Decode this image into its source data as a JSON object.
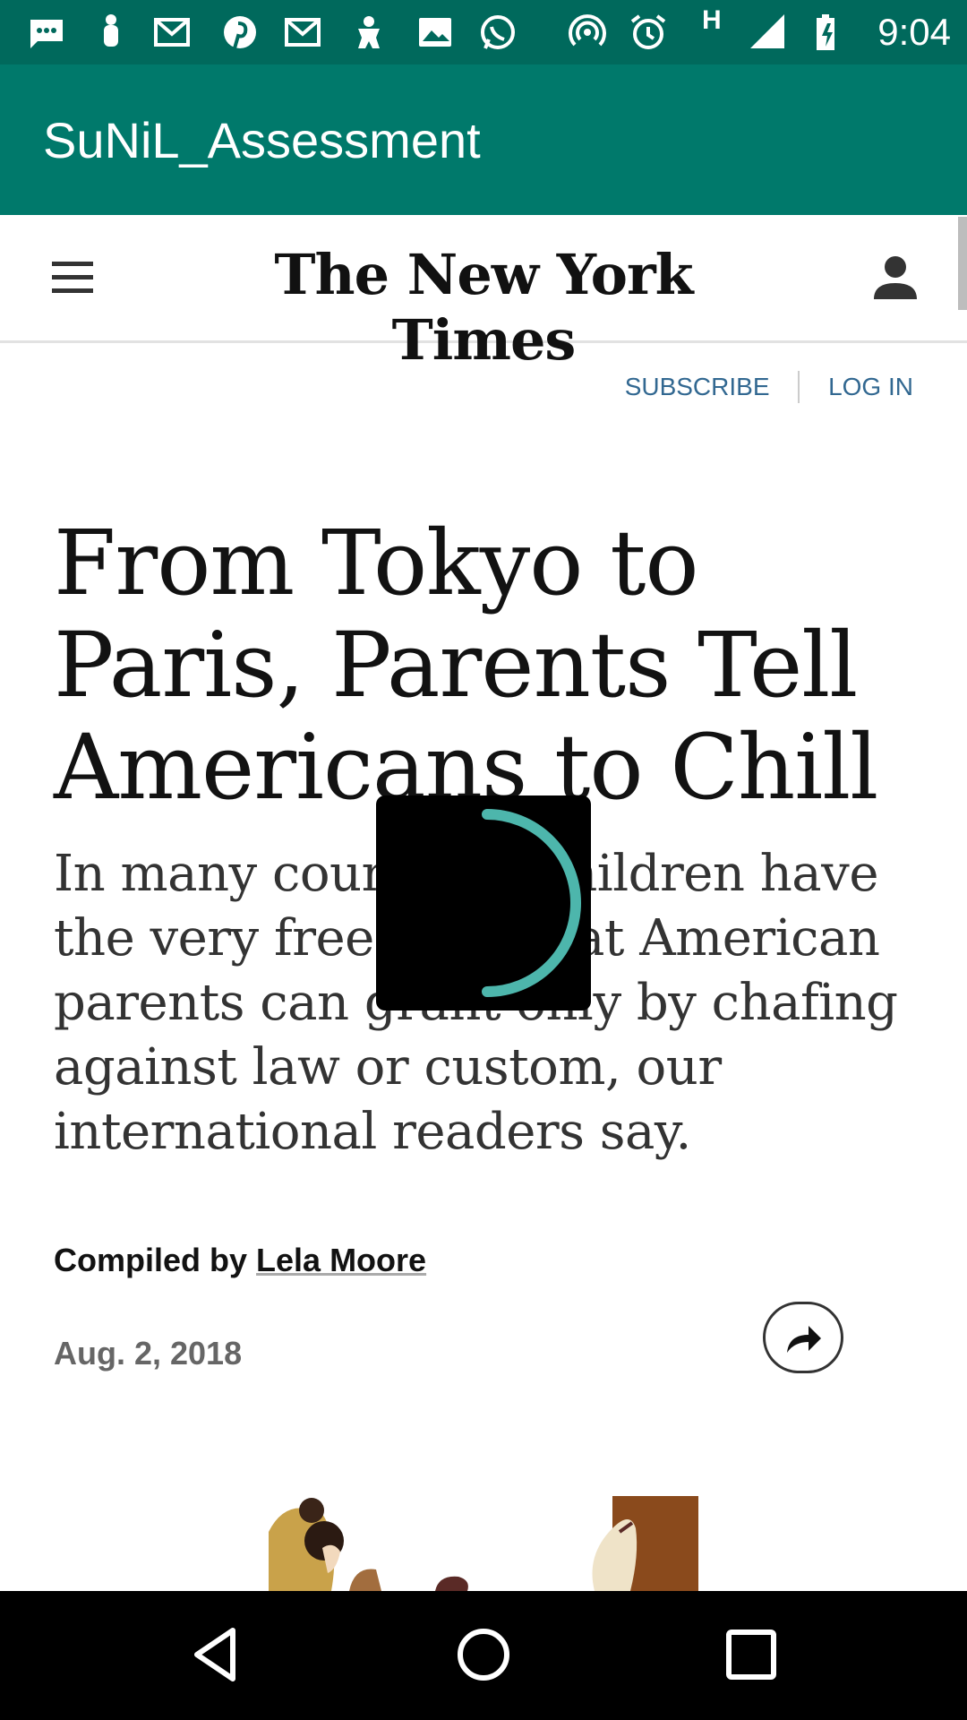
{
  "status_bar": {
    "time": "9:04",
    "network_type": "H",
    "icons": [
      "sms-icon",
      "bell-icon",
      "gmail-icon",
      "pinterest-icon",
      "gmail-icon",
      "game-icon",
      "photo-icon",
      "whatsapp-icon",
      "hotspot-icon",
      "alarm-icon",
      "signal-icon",
      "battery-charging-icon"
    ]
  },
  "app_bar": {
    "title": "SuNiL_Assessment"
  },
  "nyt_header": {
    "logo_text": "The New York Times",
    "menu_icon": "hamburger-menu-icon",
    "user_icon": "account-icon"
  },
  "links": {
    "subscribe": "SUBSCRIBE",
    "login": "LOG IN"
  },
  "article": {
    "headline": "From Tokyo to Paris, Parents Tell Americans to Chill",
    "summary": "In many countries, children have the very freedoms that American parents can grant only by chafing against law or custom, our international readers say.",
    "byline_prefix": "Compiled by ",
    "author": "Lela Moore",
    "date": "Aug. 2, 2018",
    "share_icon": "share-arrow-icon"
  },
  "loading": {
    "spinner_color": "#4db6ac"
  },
  "colors": {
    "status_bar": "#00695c",
    "app_bar": "#00796b",
    "link": "#326891"
  },
  "nav_bar": {
    "icons": [
      "back-icon",
      "home-icon",
      "recents-icon"
    ]
  }
}
